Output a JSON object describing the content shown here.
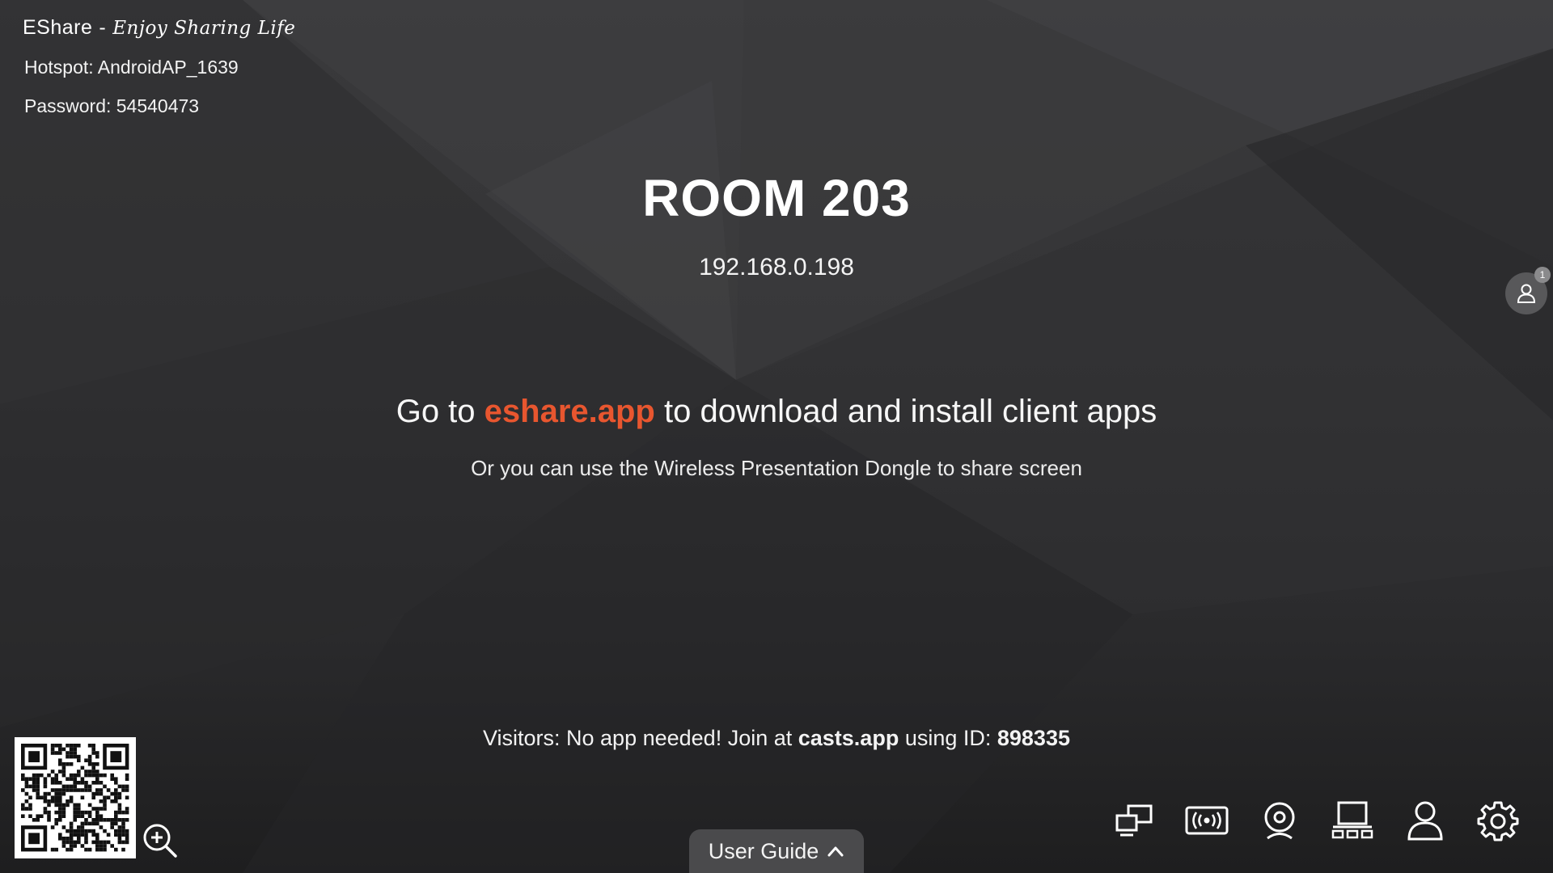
{
  "header": {
    "brand_name": "EShare",
    "brand_separator": "-",
    "brand_tagline": "Enjoy Sharing Life",
    "hotspot": "Hotspot: AndroidAP_1639",
    "password": "Password: 54540473"
  },
  "main": {
    "room_name": "ROOM 203",
    "ip_address": "192.168.0.198",
    "download_prefix": "Go to ",
    "download_link": "eshare.app",
    "download_suffix": " to download and install client apps",
    "dongle_text": "Or you can use the Wireless Presentation Dongle to share screen"
  },
  "visitors": {
    "prefix": "Visitors: No app needed! Join at ",
    "site": "casts.app",
    "middle": " using ID: ",
    "id": "898335"
  },
  "side_panel": {
    "icon": "user-icon",
    "badge_count": "1"
  },
  "bottom_left": {
    "qr_icon": "qr-code",
    "zoom_icon": "zoom-in-icon"
  },
  "user_guide": {
    "label": "User Guide",
    "icon": "chevron-up-icon"
  },
  "toolbar": {
    "icons": [
      "multi-screen-icon",
      "broadcast-icon",
      "camera-icon",
      "screen-group-icon",
      "user-icon",
      "settings-icon"
    ]
  },
  "colors": {
    "accent": "#e8562f",
    "background": "#333335",
    "text": "#ffffff"
  }
}
